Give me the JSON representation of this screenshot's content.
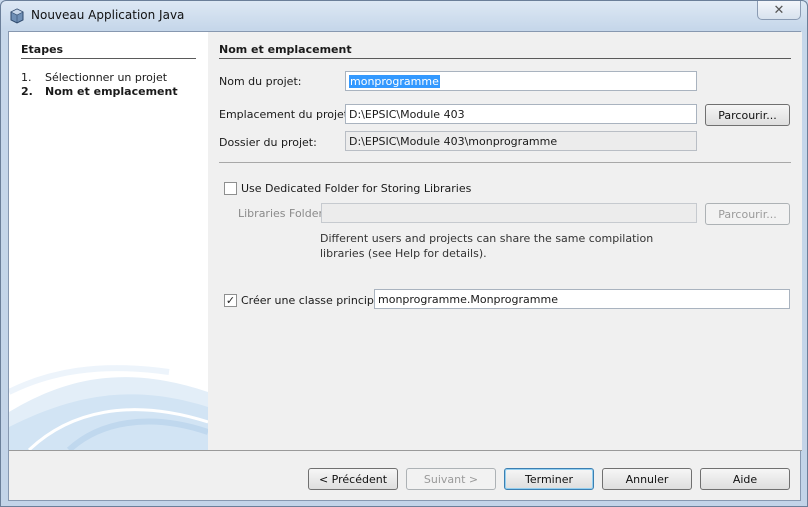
{
  "window": {
    "title": "Nouveau Application Java",
    "close_glyph": "✕",
    "icon": "java-app-icon"
  },
  "steps": {
    "title": "Etapes",
    "items": [
      {
        "num": "1.",
        "label": "Sélectionner un projet"
      },
      {
        "num": "2.",
        "label": "Nom et emplacement"
      }
    ]
  },
  "form": {
    "section_title": "Nom et emplacement",
    "project_name_label": "Nom du projet:",
    "project_name_value": "monprogramme",
    "location_label": "Emplacement du projet:",
    "location_value": "D:\\EPSIC\\Module 403",
    "browse_label": "Parcourir...",
    "folder_label": "Dossier du projet:",
    "folder_value": "D:\\EPSIC\\Module 403\\monprogramme",
    "dedicated_folder_label": "Use Dedicated Folder for Storing Libraries",
    "libraries_folder_label": "Libraries Folder:",
    "libraries_browse_label": "Parcourir...",
    "help_text": "Different users and projects can share the same compilation libraries (see Help for details).",
    "main_class_label": "Créer une classe principale",
    "main_class_value": "monprogramme.Monprogramme",
    "check_glyph": "✓"
  },
  "buttons": {
    "previous": "< Précédent",
    "next": "Suivant >",
    "finish": "Terminer",
    "cancel": "Annuler",
    "help": "Aide"
  }
}
